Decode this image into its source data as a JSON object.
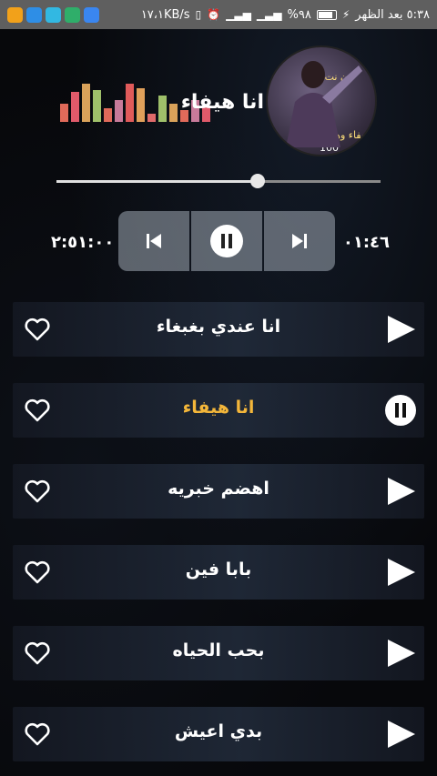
{
  "status_bar": {
    "time": "٥:٣٨ بعد الظهر",
    "battery": "%٩٨",
    "network_speed": "١٧،١KB/s",
    "app_icon_colors": [
      "#f2a11a",
      "#2e8ee6",
      "#32b8e2",
      "#2fae6a",
      "#3a86f0"
    ]
  },
  "now_playing": {
    "title": "انا هيفاء",
    "cover_text_top": "ن نت",
    "cover_text_bottom": "هيفاء وهبي",
    "cover_text_number": "100",
    "elapsed": "٠١:٤٦",
    "total": "٢:٥١:٠٠",
    "progress": 0.62
  },
  "equalizer": {
    "colors": [
      "#e06a5a",
      "#e05a6a",
      "#d9a25a",
      "#9fc06a",
      "#e06a5a",
      "#c87a9a",
      "#e05a5a",
      "#e0a05a",
      "#e06a6a",
      "#9fc06a",
      "#d9a25a",
      "#e06a5a",
      "#c87a9a",
      "#e05a6a"
    ],
    "levels": [
      0.45,
      0.75,
      0.95,
      0.8,
      0.35,
      0.55,
      0.95,
      0.85,
      0.2,
      0.65,
      0.45,
      0.3,
      0.55,
      0.4
    ]
  },
  "controls": {
    "prev_icon": "skip-previous-icon",
    "pause_icon": "pause-icon",
    "next_icon": "skip-next-icon"
  },
  "playlist": [
    {
      "title": "انا عندي بغبغاء",
      "state": "play",
      "heart_icon": "heart-outline-icon"
    },
    {
      "title": "انا هيفاء",
      "state": "pause",
      "heart_icon": "heart-outline-icon"
    },
    {
      "title": "اهضم خبريه",
      "state": "play",
      "heart_icon": "heart-outline-icon"
    },
    {
      "title": "بابا فين",
      "state": "play",
      "heart_icon": "heart-outline-icon"
    },
    {
      "title": "بحب الحياه",
      "state": "play",
      "heart_icon": "heart-outline-icon"
    },
    {
      "title": "بدي اعيش",
      "state": "play",
      "heart_icon": "heart-outline-icon"
    }
  ],
  "accent": "#f3b63a"
}
